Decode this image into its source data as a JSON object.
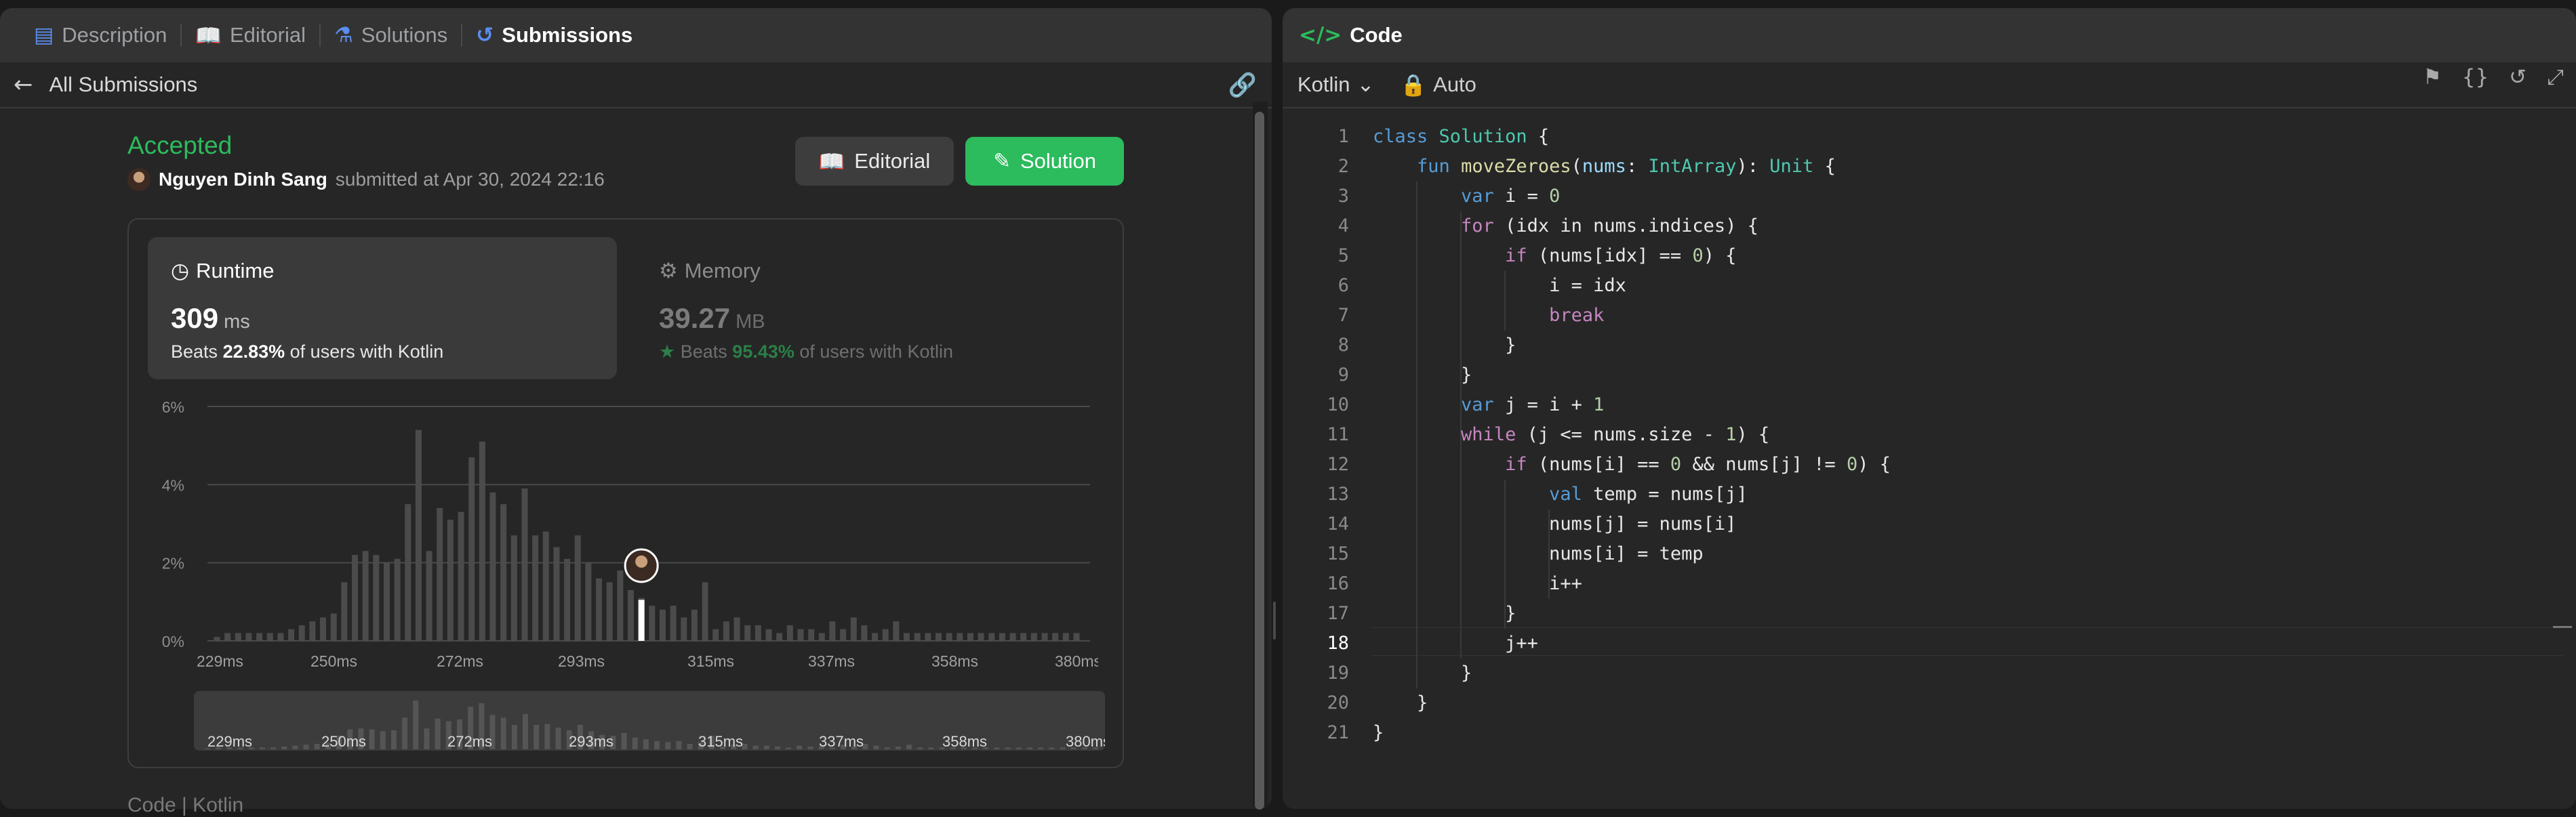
{
  "left_tabs": [
    {
      "label": "Description",
      "icon": "description-icon",
      "active": false
    },
    {
      "label": "Editorial",
      "icon": "book-icon",
      "active": false
    },
    {
      "label": "Solutions",
      "icon": "flask-icon",
      "active": false
    },
    {
      "label": "Submissions",
      "icon": "history-icon",
      "active": true
    }
  ],
  "subbar": {
    "back_label": "All Submissions"
  },
  "submission": {
    "status": "Accepted",
    "author": "Nguyen Dinh Sang",
    "submitted_text": "submitted at Apr 30, 2024 22:16"
  },
  "buttons": {
    "editorial": "Editorial",
    "solution": "Solution"
  },
  "runtime": {
    "title": "Runtime",
    "value": "309",
    "unit": "ms",
    "beats_prefix": "Beats",
    "beats_pct": "22.83%",
    "beats_suffix": "of users with Kotlin"
  },
  "memory": {
    "title": "Memory",
    "value": "39.27",
    "unit": "MB",
    "beats_prefix": "Beats",
    "beats_pct": "95.43%",
    "beats_suffix": "of users with Kotlin"
  },
  "chart_data": {
    "type": "bar",
    "y_ticks": [
      "0%",
      "2%",
      "4%",
      "6%"
    ],
    "ylim": [
      0,
      6
    ],
    "x_ticks": [
      "229ms",
      "250ms",
      "272ms",
      "293ms",
      "315ms",
      "337ms",
      "358ms",
      "380ms"
    ],
    "values": [
      0.1,
      0.2,
      0.2,
      0.2,
      0.2,
      0.2,
      0.2,
      0.3,
      0.4,
      0.5,
      0.6,
      0.7,
      1.5,
      2.2,
      2.3,
      2.2,
      2.0,
      2.1,
      3.5,
      5.4,
      2.3,
      3.4,
      3.1,
      3.3,
      4.7,
      5.1,
      3.8,
      3.5,
      2.7,
      3.9,
      2.7,
      2.8,
      2.4,
      2.1,
      2.7,
      2.0,
      1.6,
      1.5,
      1.8,
      1.3,
      1.1,
      0.9,
      0.8,
      0.9,
      0.6,
      0.8,
      1.5,
      0.3,
      0.5,
      0.6,
      0.4,
      0.4,
      0.3,
      0.2,
      0.4,
      0.3,
      0.3,
      0.2,
      0.5,
      0.3,
      0.6,
      0.4,
      0.2,
      0.3,
      0.5,
      0.2,
      0.2,
      0.2,
      0.2,
      0.2,
      0.2,
      0.2,
      0.2,
      0.2,
      0.2,
      0.2,
      0.2,
      0.2,
      0.2,
      0.2,
      0.2,
      0.2
    ],
    "highlight_index": 40,
    "highlight_value": 1.05,
    "grid": true
  },
  "editor": {
    "tab_label": "Code",
    "language": "Kotlin",
    "mode": "Auto",
    "current_line": 18
  },
  "code_lines": [
    [
      [
        "kw",
        "class"
      ],
      [
        "t",
        " "
      ],
      [
        "cls",
        "Solution"
      ],
      [
        "t",
        " {"
      ]
    ],
    [
      [
        "t",
        "    "
      ],
      [
        "kw",
        "fun"
      ],
      [
        "t",
        " "
      ],
      [
        "fn",
        "moveZeroes"
      ],
      [
        "t",
        "("
      ],
      [
        "prm",
        "nums"
      ],
      [
        "t",
        ": "
      ],
      [
        "cls",
        "IntArray"
      ],
      [
        "t",
        "): "
      ],
      [
        "cls",
        "Unit"
      ],
      [
        "t",
        " {"
      ]
    ],
    [
      [
        "t",
        "        "
      ],
      [
        "kw",
        "var"
      ],
      [
        "t",
        " i = "
      ],
      [
        "num",
        "0"
      ]
    ],
    [
      [
        "t",
        "        "
      ],
      [
        "kw2",
        "for"
      ],
      [
        "t",
        " (idx in nums.indices) {"
      ]
    ],
    [
      [
        "t",
        "            "
      ],
      [
        "kw2",
        "if"
      ],
      [
        "t",
        " (nums[idx] == "
      ],
      [
        "num",
        "0"
      ],
      [
        "t",
        ") {"
      ]
    ],
    [
      [
        "t",
        "                i = idx"
      ]
    ],
    [
      [
        "t",
        "                "
      ],
      [
        "kw2",
        "break"
      ]
    ],
    [
      [
        "t",
        "            }"
      ]
    ],
    [
      [
        "t",
        "        }"
      ]
    ],
    [
      [
        "t",
        "        "
      ],
      [
        "kw",
        "var"
      ],
      [
        "t",
        " j = i + "
      ],
      [
        "num",
        "1"
      ]
    ],
    [
      [
        "t",
        "        "
      ],
      [
        "kw2",
        "while"
      ],
      [
        "t",
        " (j <= nums.size - "
      ],
      [
        "num",
        "1"
      ],
      [
        "t",
        ") {"
      ]
    ],
    [
      [
        "t",
        "            "
      ],
      [
        "kw2",
        "if"
      ],
      [
        "t",
        " (nums[i] == "
      ],
      [
        "num",
        "0"
      ],
      [
        "t",
        " && nums[j] != "
      ],
      [
        "num",
        "0"
      ],
      [
        "t",
        ") {"
      ]
    ],
    [
      [
        "t",
        "                "
      ],
      [
        "kw",
        "val"
      ],
      [
        "t",
        " temp = nums[j]"
      ]
    ],
    [
      [
        "t",
        "                nums[j] = nums[i]"
      ]
    ],
    [
      [
        "t",
        "                nums[i] = temp"
      ]
    ],
    [
      [
        "t",
        "                i++"
      ]
    ],
    [
      [
        "t",
        "            }"
      ]
    ],
    [
      [
        "t",
        "            j++"
      ]
    ],
    [
      [
        "t",
        "        }"
      ]
    ],
    [
      [
        "t",
        "    }"
      ]
    ],
    [
      [
        "t",
        "}"
      ]
    ]
  ],
  "footer_tabs": "Code  |  Kotlin"
}
